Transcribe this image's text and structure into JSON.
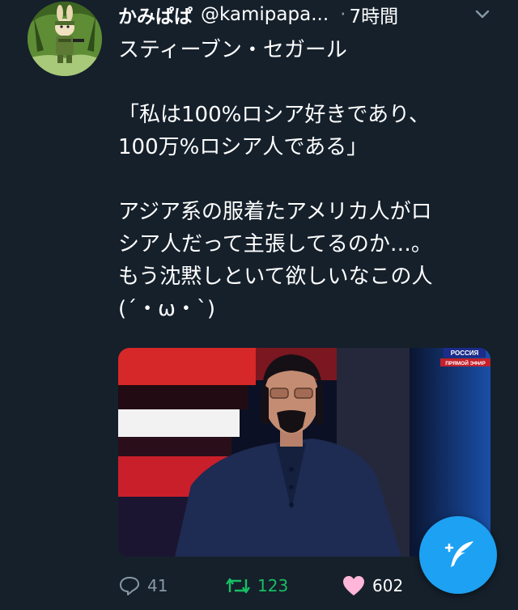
{
  "tweet": {
    "display_name": "かみぱぱ",
    "handle": "@kamipapa...",
    "separator": "·",
    "time": "7時間",
    "text": "スティーブン・セガール\n\n「私は100%ロシア好きであり、\n100万%ロシア人である」\n\nアジア系の服着たアメリカ人がロ\nシア人だって主張してるのか…。\nもう沈黙しといて欲しいなこの人\n(´・ω・`)",
    "media": {
      "channel_name": "РОССИЯ",
      "channel_status": "ПРЯМОЙ ЭФИР"
    }
  },
  "actions": {
    "reply_count": "41",
    "retweet_count": "123",
    "like_count": "602"
  },
  "colors": {
    "background": "#15202b",
    "text": "#ffffff",
    "muted": "#8899a6",
    "retweet": "#17bf63",
    "like": "#ffb6d9",
    "accent": "#1da1f2"
  },
  "icons": {
    "menu": "chevron-down-icon",
    "reply": "reply-icon",
    "retweet": "retweet-icon",
    "like": "heart-icon",
    "compose": "compose-tweet-icon"
  }
}
